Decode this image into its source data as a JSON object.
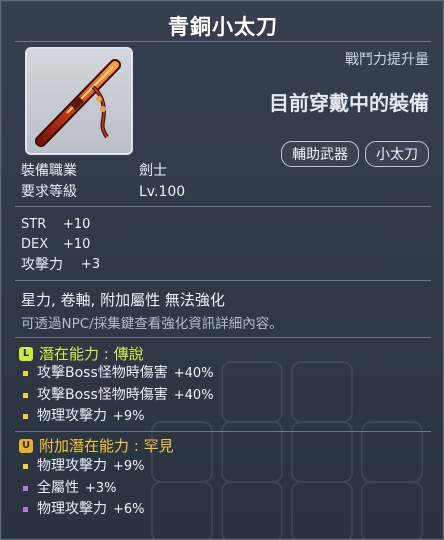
{
  "title": "青銅小太刀",
  "power_label": "戰鬥力提升量",
  "equipped_text": "目前穿戴中的裝備",
  "tags": [
    "輔助武器",
    "小太刀"
  ],
  "requirements": [
    {
      "key": "裝備職業",
      "value": "劍士"
    },
    {
      "key": "要求等級",
      "value": "Lv.100"
    }
  ],
  "stats": [
    {
      "key": "STR",
      "value": "+10"
    },
    {
      "key": "DEX",
      "value": "+10"
    },
    {
      "key": "攻擊力",
      "value": "+3"
    }
  ],
  "flags": "星力, 卷軸, 附加屬性 無法強化",
  "note": "可透過NPC/採集鍵查看強化資訊詳細內容。",
  "potential": {
    "badge": "L",
    "label": "潛在能力 : 傳說",
    "color": "#ccf24a",
    "lines": [
      {
        "name": "攻擊Boss怪物時傷害",
        "value": "+40%"
      },
      {
        "name": "攻擊Boss怪物時傷害",
        "value": "+40%"
      },
      {
        "name": "物理攻擊力",
        "value": "+9%"
      }
    ]
  },
  "additional_potential": {
    "badge": "U",
    "label": "附加潛在能力 : 罕見",
    "color": "#f3c73a",
    "lines": [
      {
        "name": "物理攻擊力",
        "value": "+9%",
        "bullet": "yellow"
      },
      {
        "name": "全屬性",
        "value": "+3%",
        "bullet": "purple"
      },
      {
        "name": "物理攻擊力",
        "value": "+6%",
        "bullet": "purple"
      }
    ]
  },
  "item_icon": "bronze-kodachi-sword-icon"
}
